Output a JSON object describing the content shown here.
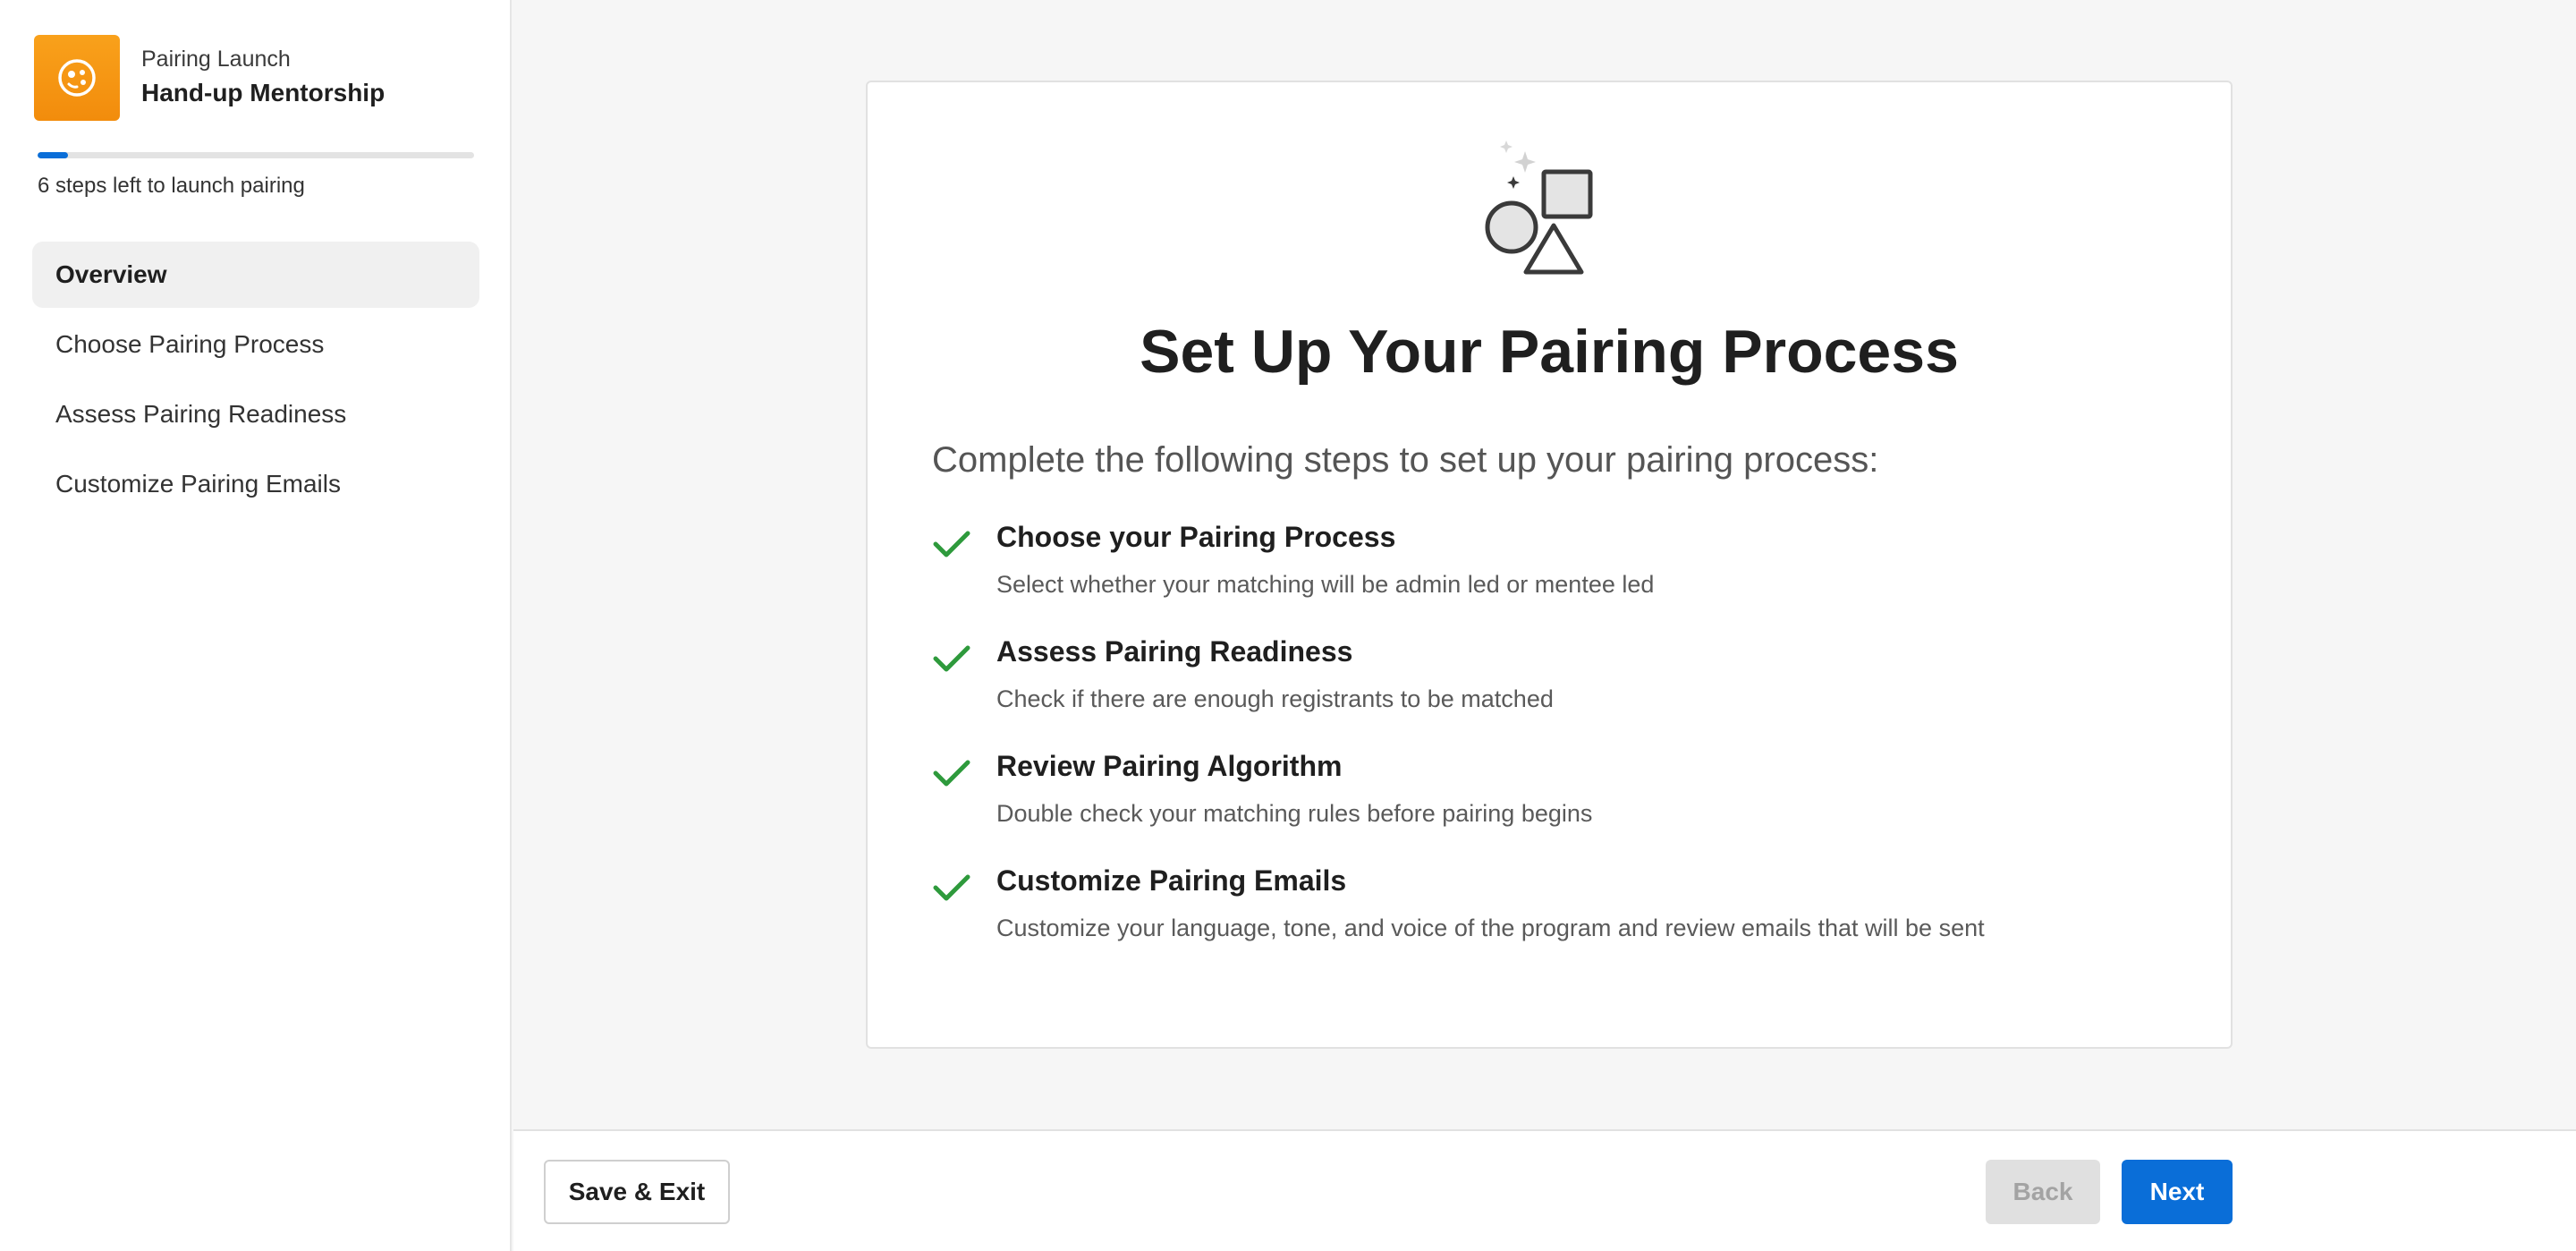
{
  "sidebar": {
    "brand": {
      "subtitle": "Pairing Launch",
      "title": "Hand-up Mentorship",
      "logo_icon": "palette-icon",
      "logo_color": "#f59a12"
    },
    "progress": {
      "fraction": 0.07,
      "text": "6 steps left to launch pairing"
    },
    "nav": [
      {
        "label": "Overview",
        "active": true
      },
      {
        "label": "Choose Pairing Process",
        "active": false
      },
      {
        "label": "Assess Pairing Readiness",
        "active": false
      },
      {
        "label": "Customize Pairing Emails",
        "active": false
      }
    ]
  },
  "card": {
    "illustration_icon": "shapes-icon",
    "title": "Set Up Your Pairing Process",
    "intro": "Complete the following steps to set up your pairing process:",
    "steps": [
      {
        "title": "Choose your Pairing Process",
        "description": "Select whether your matching will be admin led or mentee led"
      },
      {
        "title": "Assess Pairing Readiness",
        "description": "Check if there are enough registrants to be matched"
      },
      {
        "title": "Review Pairing Algorithm",
        "description": "Double check your matching rules before pairing begins"
      },
      {
        "title": "Customize Pairing Emails",
        "description": "Customize your language, tone, and voice of the program and review emails that will be sent"
      }
    ],
    "check_color": "#2e9a3c"
  },
  "footer": {
    "save_label": "Save & Exit",
    "back_label": "Back",
    "next_label": "Next",
    "accent_color": "#0a6ed8"
  }
}
